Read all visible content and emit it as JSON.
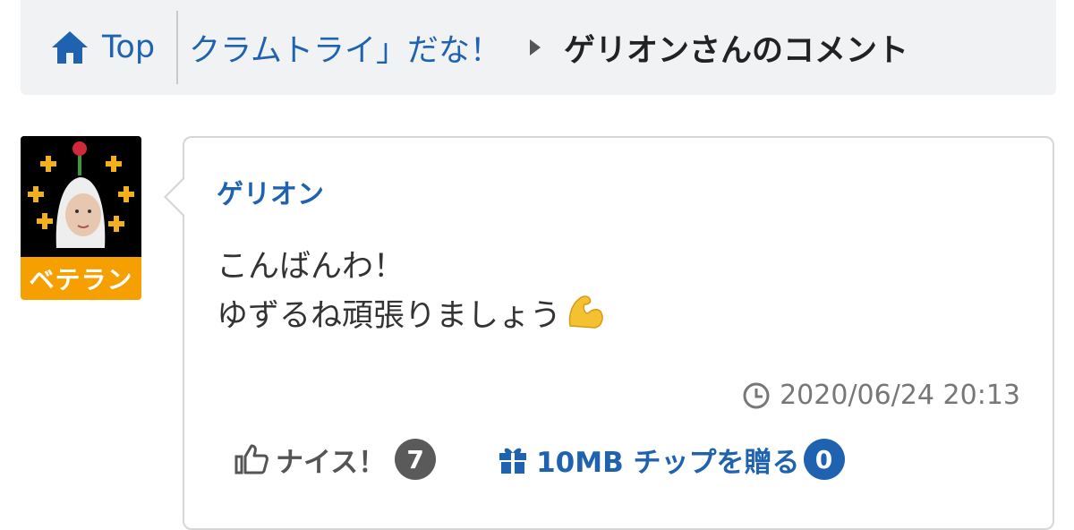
{
  "breadcrumb": {
    "home_label": "Top",
    "thread_title": "クラムトライ」だな！",
    "current_page": "ゲリオンさんのコメント"
  },
  "user": {
    "rank_badge": "ベテラン",
    "name": "ゲリオン"
  },
  "comment": {
    "lines": [
      "こんばんわ！",
      "ゆずるね頑張りましょう"
    ],
    "emoji": "flexed-biceps-emoji",
    "timestamp": "2020/06/24 20:13"
  },
  "actions": {
    "nice_label": "ナイス！",
    "nice_count": "7",
    "tip_label": "10MB チップを贈る",
    "tip_count": "0"
  },
  "colors": {
    "link_blue": "#1f63b0",
    "badge_orange": "#f5a000",
    "breadcrumb_bg": "#f1f2f4",
    "muted_text": "#777777"
  }
}
